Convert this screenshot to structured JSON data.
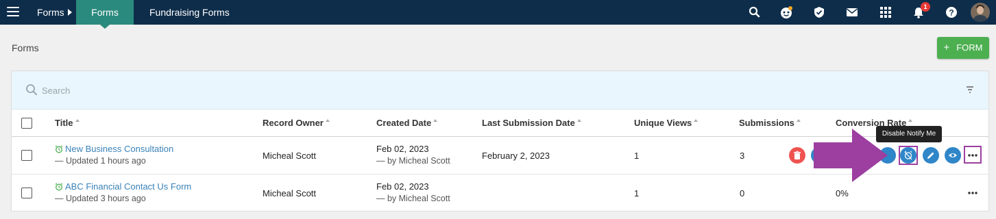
{
  "topbar": {
    "breadcrumb_root": "Forms",
    "active_tab": "Forms",
    "secondary_tab": "Fundraising Forms",
    "notification_count": "1",
    "icons": [
      "menu-icon",
      "search-icon",
      "assistant-icon",
      "shield-check-icon",
      "mail-icon",
      "apps-grid-icon",
      "bell-icon",
      "help-icon"
    ]
  },
  "page": {
    "title": "Forms",
    "add_button_label": "FORM"
  },
  "search": {
    "placeholder": "Search"
  },
  "table": {
    "columns": [
      "Title",
      "Record Owner",
      "Created Date",
      "Last Submission Date",
      "Unique Views",
      "Submissions",
      "Conversion Rate"
    ],
    "rows": [
      {
        "title": "New Business Consultation",
        "updated": "— Updated 1 hours ago",
        "owner": "Micheal Scott",
        "created": "Feb 02, 2023",
        "created_by": "— by Micheal Scott",
        "last_submission": "February 2, 2023",
        "unique_views": "1",
        "submissions": "3",
        "conversion_rate": ""
      },
      {
        "title": "ABC Financial Contact Us Form",
        "updated": "— Updated 3 hours ago",
        "owner": "Micheal Scott",
        "created": "Feb 02, 2023",
        "created_by": "— by Micheal Scott",
        "last_submission": "",
        "unique_views": "1",
        "submissions": "0",
        "conversion_rate": "0%"
      }
    ]
  },
  "tooltip": {
    "text": "Disable Notify Me"
  },
  "colors": {
    "topbar": "#0e2d4a",
    "active_tab": "#2b8a7e",
    "add_button": "#4caf50",
    "action_blue": "#2f86c8",
    "delete_red": "#ef5350",
    "highlight": "#9c3fa0",
    "link": "#3a82b8"
  }
}
